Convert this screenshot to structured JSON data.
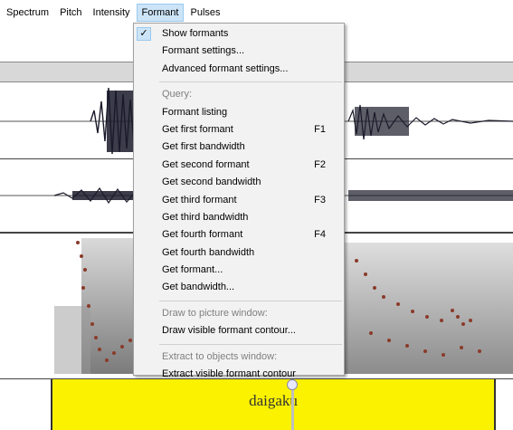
{
  "menubar": {
    "items": [
      "Spectrum",
      "Pitch",
      "Intensity",
      "Formant",
      "Pulses"
    ]
  },
  "dropdown": {
    "show_formants": "Show formants",
    "formant_settings": "Formant settings...",
    "advanced_formant_settings": "Advanced formant settings...",
    "query_header": "Query:",
    "formant_listing": "Formant listing",
    "get_first_formant": "Get first formant",
    "get_first_formant_shortcut": "F1",
    "get_first_bandwidth": "Get first bandwidth",
    "get_second_formant": "Get second formant",
    "get_second_formant_shortcut": "F2",
    "get_second_bandwidth": "Get second bandwidth",
    "get_third_formant": "Get third formant",
    "get_third_formant_shortcut": "F3",
    "get_third_bandwidth": "Get third bandwidth",
    "get_fourth_formant": "Get fourth formant",
    "get_fourth_formant_shortcut": "F4",
    "get_fourth_bandwidth": "Get fourth bandwidth",
    "get_formant": "Get formant...",
    "get_bandwidth": "Get bandwidth...",
    "draw_header": "Draw to picture window:",
    "draw_visible_formant_contour": "Draw visible formant contour...",
    "extract_header": "Extract to objects window:",
    "extract_visible_formant_contour": "Extract visible formant contour"
  },
  "tier": {
    "label": "daigaku"
  },
  "colors": {
    "tier_background": "#fbf200",
    "menu_highlight": "#cce4f7",
    "formant_dots": "#8b3a2a"
  }
}
